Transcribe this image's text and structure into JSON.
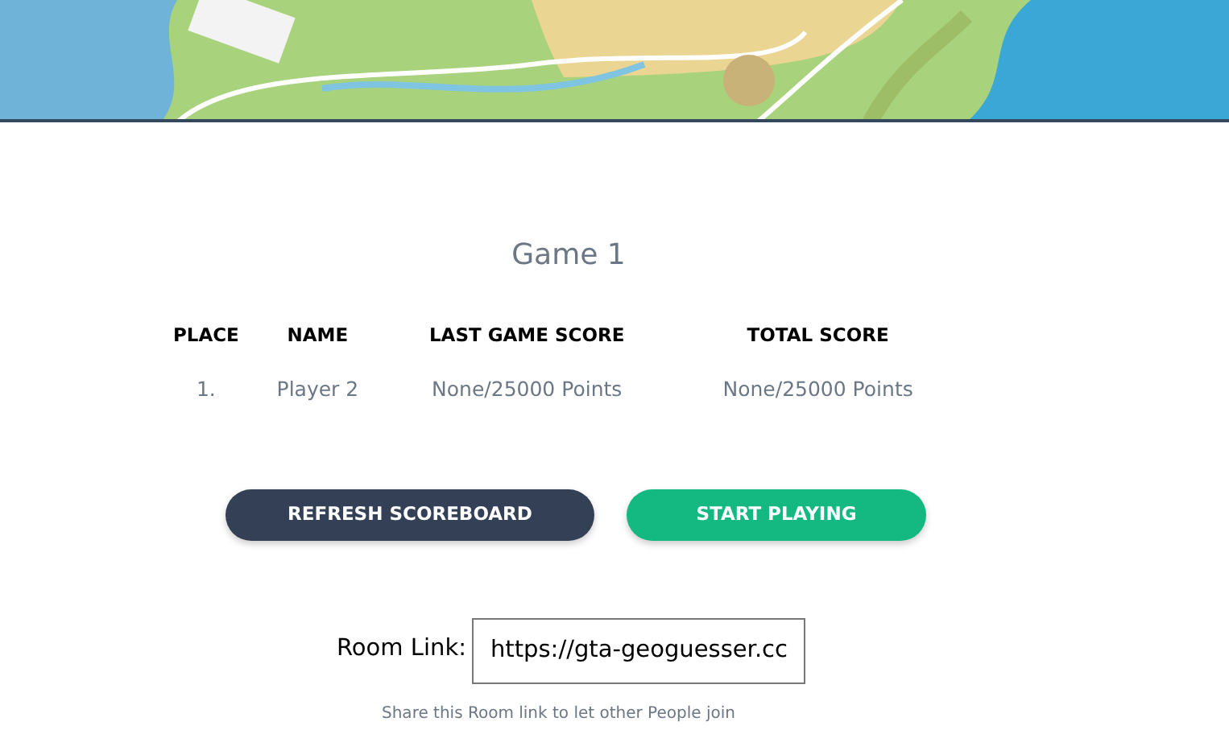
{
  "title": "Game 1",
  "scoreboard": {
    "columns": [
      "PLACE",
      "NAME",
      "LAST GAME SCORE",
      "TOTAL SCORE"
    ],
    "rows": [
      {
        "place": "1.",
        "name": "Player 2",
        "last_game_score": "None/25000 Points",
        "total_score": "None/25000 Points"
      }
    ]
  },
  "buttons": [
    {
      "label": "REFRESH SCOREBOARD",
      "kind": "dark"
    },
    {
      "label": "START PLAYING",
      "kind": "green"
    }
  ],
  "room_link": {
    "label": "Room Link:",
    "value": "https://gta-geoguesser.cc"
  },
  "hint": "Share this Room link to let other People join"
}
